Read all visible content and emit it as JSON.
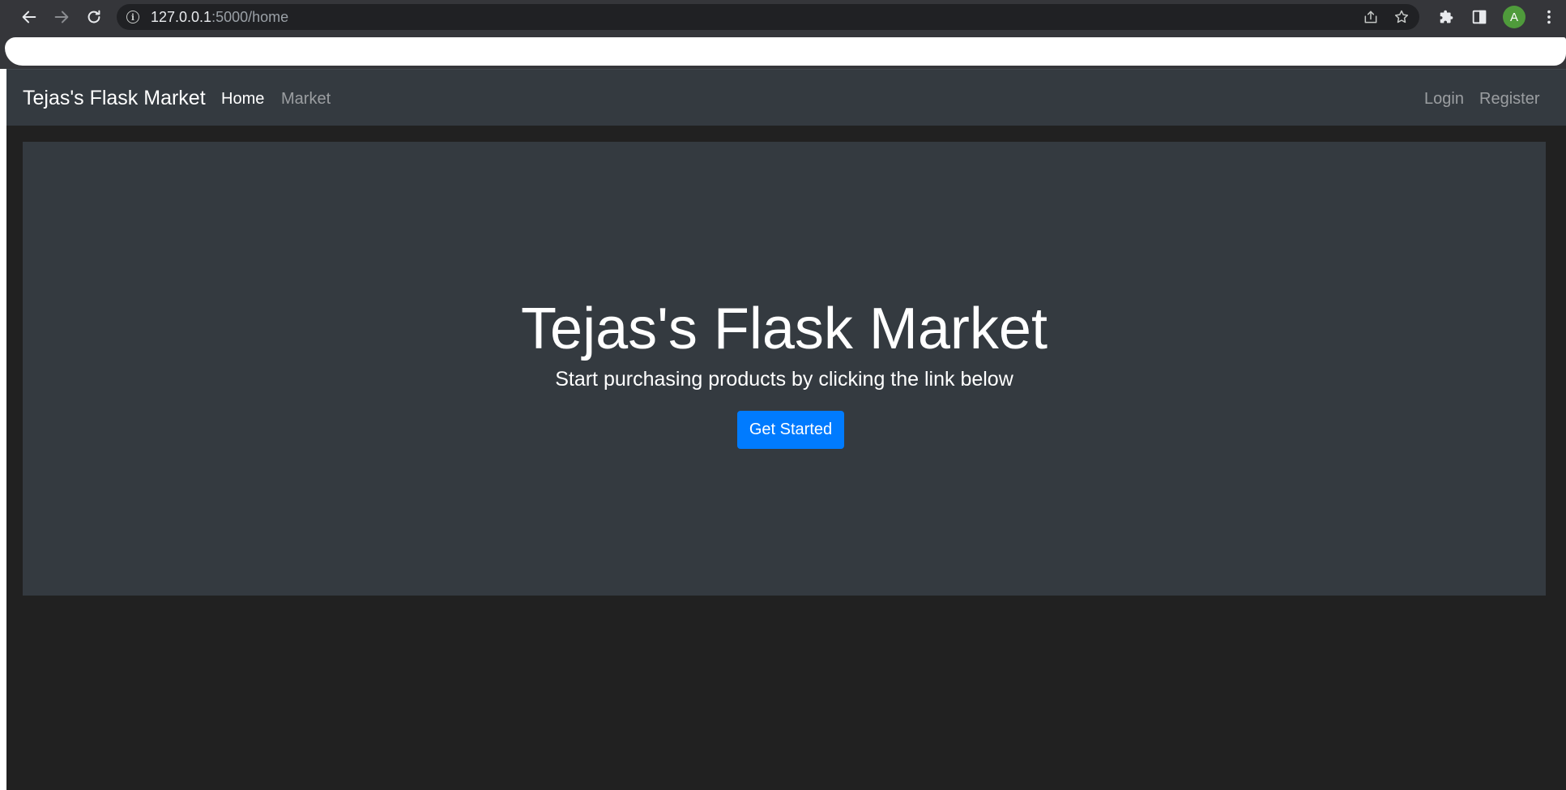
{
  "browser": {
    "url_host": "127.0.0.1",
    "url_path": ":5000/home",
    "profile_initial": "A",
    "icons": {
      "back": "arrow-left-icon",
      "forward": "arrow-right-icon",
      "reload": "reload-icon",
      "site_info": "info-icon",
      "share": "share-icon",
      "bookmark": "star-icon",
      "extensions": "puzzle-icon",
      "side_panel": "side-panel-icon",
      "menu": "kebab-menu-icon"
    },
    "colors": {
      "chrome_bg": "#35363a",
      "omnibox_bg": "#202124",
      "avatar_bg": "#4f9b3b"
    }
  },
  "navbar": {
    "brand": "Tejas's Flask Market",
    "links": [
      {
        "label": "Home",
        "active": true
      },
      {
        "label": "Market",
        "active": false
      }
    ],
    "right_links": [
      {
        "label": "Login"
      },
      {
        "label": "Register"
      }
    ]
  },
  "hero": {
    "title": "Tejas's Flask Market",
    "lead": "Start purchasing products by clicking the link below",
    "button_label": "Get Started"
  },
  "colors": {
    "page_bg": "#212121",
    "panel_bg": "#343a40",
    "primary": "#007bff"
  }
}
